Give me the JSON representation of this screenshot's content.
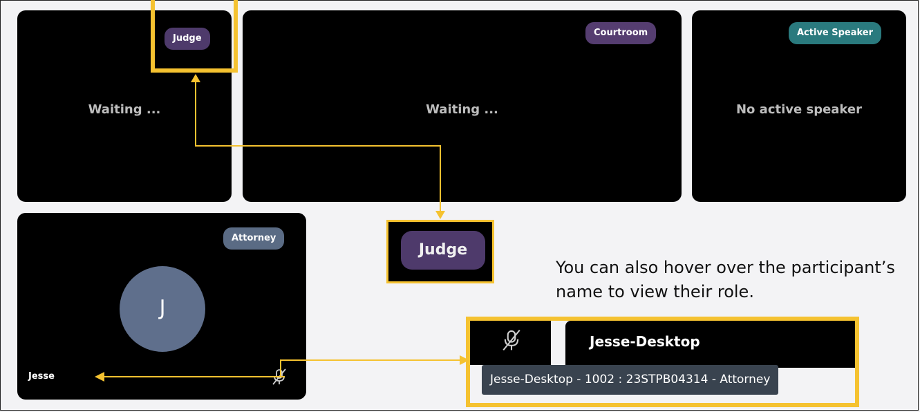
{
  "tiles": {
    "judge": {
      "badge": "Judge",
      "status": "Waiting ..."
    },
    "courtroom": {
      "badge": "Courtroom",
      "status": "Waiting ..."
    },
    "active_speaker": {
      "badge": "Active Speaker",
      "status": "No active speaker"
    },
    "attorney": {
      "badge": "Attorney",
      "avatar_initial": "J",
      "name": "Jesse"
    }
  },
  "callout": {
    "judge_badge_zoom": "Judge",
    "hover_tip": "You can also hover over the participant’s name to view their role.",
    "participant_name": "Jesse-Desktop",
    "tooltip": "Jesse-Desktop - 1002 : 23STPB04314 - Attorney"
  },
  "icons": {
    "mic_muted": "mic-muted-icon"
  },
  "colors": {
    "judge_badge": "#4e3a6b",
    "courtroom_badge": "#553d70",
    "active_speaker_badge": "#2a7a7e",
    "attorney_badge": "#5a6b84",
    "avatar": "#5f6f8c",
    "highlight": "#f5c230",
    "tooltip_bg": "#39434f"
  }
}
